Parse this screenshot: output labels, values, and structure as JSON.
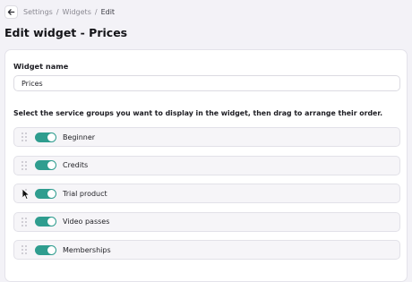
{
  "breadcrumb": {
    "items": [
      "Settings",
      "Widgets",
      "Edit"
    ],
    "separator": "/"
  },
  "page": {
    "title": "Edit widget - Prices"
  },
  "form": {
    "name_label": "Widget name",
    "name_value": "Prices",
    "instructions": "Select the service groups you want to display in the widget, then drag to arrange their order."
  },
  "service_groups": [
    {
      "label": "Beginner",
      "enabled": true
    },
    {
      "label": "Credits",
      "enabled": true
    },
    {
      "label": "Trial product",
      "enabled": true
    },
    {
      "label": "Video passes",
      "enabled": true
    },
    {
      "label": "Memberships",
      "enabled": true
    }
  ],
  "colors": {
    "accent": "#2f9d8f",
    "background": "#f3f2f7"
  },
  "icons": {
    "back": "arrow-left-icon",
    "drag": "drag-handle-icon"
  }
}
